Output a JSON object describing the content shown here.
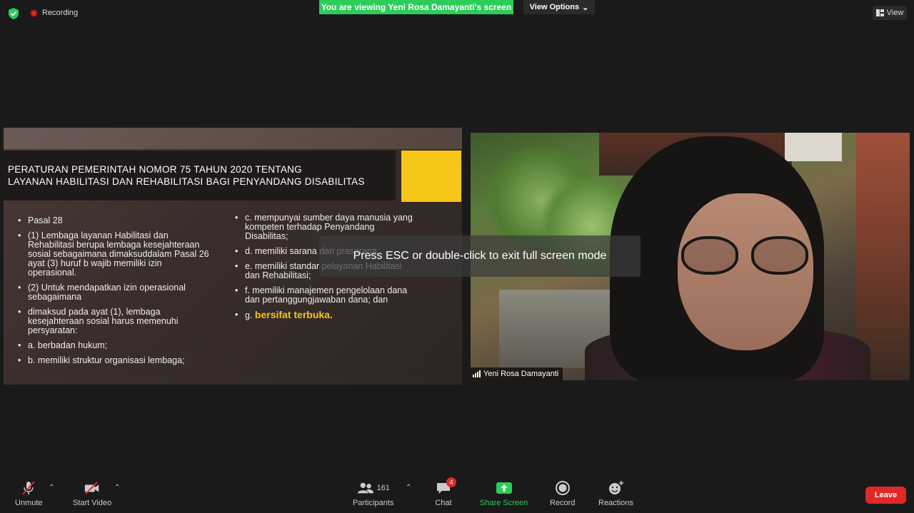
{
  "top_bar": {
    "recording_label": "Recording",
    "viewing_banner": "You are viewing Yeni Rosa Damayanti's screen",
    "view_options_label": "View Options",
    "view_label": "View"
  },
  "slide": {
    "title_line1": "PERATURAN PEMERINTAH  NOMOR 75 TAHUN 2020 TENTANG",
    "title_line2": "LAYANAN HABILITASI DAN REHABILITASI BAGI PENYANDANG DISABILITAS",
    "left_bullets": [
      "Pasal 28",
      "(1) Lembaga layanan Habilitasi dan Rehabilitasi berupa lembaga kesejahteraan sosial sebagaimana dimaksuddalam Pasal 26 ayat (3) huruf b wajib memiliki izin operasional.",
      "(2) Untuk mendapatkan izin operasional sebagaimana",
      "dimaksud pada ayat (1), lembaga kesejahteraan sosial harus memenuhi persyaratan:",
      "a. berbadan hukum;",
      "b. memiliki struktur organisasi lembaga;"
    ],
    "right_bullets": [
      "c. mempunyai sumber daya manusia yang kompeten terhadap Penyandang Disabilitas;",
      "d. memiliki sarana dan prasarana;",
      "e. memiliki standar pelayanan Habilitasi dan Rehabilitasi;",
      "f. memiliki manajemen pengelolaan dana dan pertanggungjawaban dana; dan"
    ],
    "last_bullet_prefix": "g.",
    "last_bullet_highlight": "bersifat terbuka."
  },
  "video": {
    "participant_name": "Yeni Rosa Damayanti"
  },
  "overlay": {
    "esc_message": "Press ESC or double-click to exit full screen mode"
  },
  "toolbar": {
    "unmute_label": "Unmute",
    "start_video_label": "Start Video",
    "participants_label": "Participants",
    "participants_count": "161",
    "chat_label": "Chat",
    "chat_badge": "4",
    "share_screen_label": "Share Screen",
    "record_label": "Record",
    "reactions_label": "Reactions",
    "leave_label": "Leave"
  },
  "colors": {
    "banner_green": "#2ccd5a",
    "leave_red": "#e02828",
    "slide_yellow": "#f5c518",
    "share_green": "#2ccd5a"
  },
  "icons": [
    "shield-icon",
    "record-dot-icon",
    "chevron-down-icon",
    "view-grid-icon",
    "signal-icon",
    "mic-muted-icon",
    "video-off-icon",
    "participants-icon",
    "chat-icon",
    "share-screen-icon",
    "record-icon",
    "reactions-icon"
  ]
}
